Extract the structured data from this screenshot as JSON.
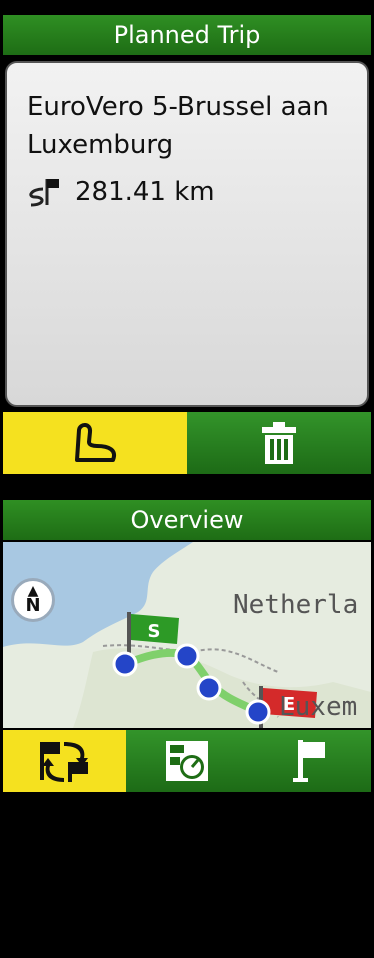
{
  "planned_trip": {
    "title": "Planned Trip",
    "trip_name": "EuroVero 5-Brussel aan Luxemburg",
    "distance": "281.41 km",
    "icons": {
      "distance": "route-flag-icon",
      "left_button": "route-shape-icon",
      "right_button": "trash-icon"
    },
    "colors": {
      "titlebar": "#1e6d15",
      "active_button": "#f5e11f"
    }
  },
  "overview": {
    "title": "Overview",
    "map_labels": {
      "country_1": "Netherla",
      "country_2": "Luxem"
    },
    "compass_label": "N",
    "start_flag": "S",
    "end_flag": "E",
    "icons": {
      "tab1": "route-switch-icon",
      "tab2": "trip-computer-icon",
      "tab3": "flag-icon"
    }
  }
}
